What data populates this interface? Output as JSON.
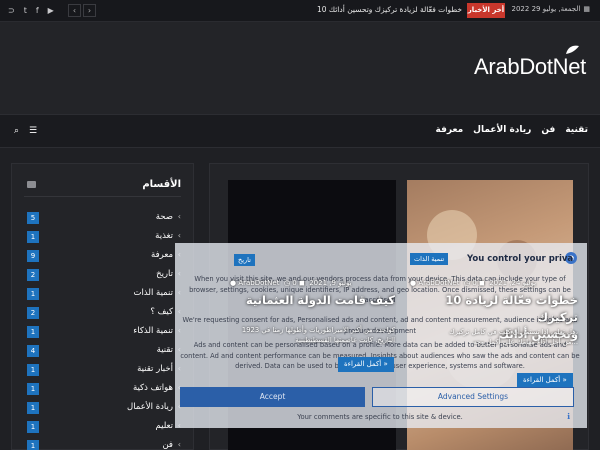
{
  "topbar": {
    "date": "الجمعة, يوليو 29 2022",
    "breaking_label": "أخر الأخبار",
    "ticker": "10 خطوات فعّالة لزيادة تركيزك وتحسين أدائك",
    "prev": "‹",
    "next": "›",
    "social": [
      "rss-icon",
      "twitter-icon",
      "facebook-icon",
      "youtube-icon"
    ]
  },
  "header": {
    "logo": "ArabDotNet"
  },
  "nav": {
    "items": [
      "تقنية",
      "فن",
      "ريادة الأعمال",
      "معرفة"
    ]
  },
  "sidebar": {
    "title": "الأقسام",
    "items": [
      {
        "name": "صحة",
        "count": "5"
      },
      {
        "name": "تغذية",
        "count": "1"
      },
      {
        "name": "معرفة",
        "count": "9"
      },
      {
        "name": "تاريخ",
        "count": "2"
      },
      {
        "name": "تنمية الذات",
        "count": "1"
      },
      {
        "name": "كيف ؟",
        "count": "2"
      },
      {
        "name": "تنمية الذكاء",
        "count": "1"
      },
      {
        "name": "تقنية",
        "count": "4"
      },
      {
        "name": "أخبار تقنية",
        "count": "1"
      },
      {
        "name": "هواتف ذكية",
        "count": "1"
      },
      {
        "name": "ريادة الأعمال",
        "count": "1"
      },
      {
        "name": "تعليم",
        "count": "1"
      },
      {
        "name": "فن",
        "count": "1"
      }
    ]
  },
  "articles": [
    {
      "badge": "تنمية الذات",
      "author": "ArabDotNet",
      "date": "يوليو 24, 2021",
      "comments": "0",
      "title_line1": "10 خطوات فعّالة لزيادة تركيزك",
      "title_line2": "وتحسين أدائك",
      "excerpt1": "هل تعلم، اذا تستمر أن كنت في كامل تركيزك،",
      "excerpt2": "من أجل أداء مهامك على أكمل وجه...",
      "readmore": "أكمل القراءة »"
    },
    {
      "badge": "تاريخ",
      "author": "ArabDotNet",
      "date": "يوليو 9, 2021",
      "comments": "0",
      "title_line1": "كيف قامت الدولة العثمانية",
      "excerpt1": "1923 كواحدة من أكبر الامبراطوريات وأطولها زمنا في",
      "excerpt2": "التاريخ. كانت عاصمتها القسطنطينية",
      "readmore": "أكمل القراءة »"
    }
  ],
  "consent": {
    "title": "You control your priva",
    "p1": "When you visit this site, we and our vendors process data from your device. This data can include your type of browser, settings, cookies, unique identifiers, IP address, and geo location. Once dismissed, these settings can be accessed",
    "p2": "We're requesting consent for ads, Personalised ads and content, ad and content measurement, audience insights and product development",
    "p3": "Ads and content can be personalised based on a profile. More data can be added to better personalise ads and content. Ad and content performance can be measured. Insights about audiences who saw the ads and content can be derived. Data can be used to build or improve user experience, systems and software.",
    "accept": "Accept",
    "advanced": "Advanced Settings",
    "footer": "Your comments are specific to this site & device."
  }
}
